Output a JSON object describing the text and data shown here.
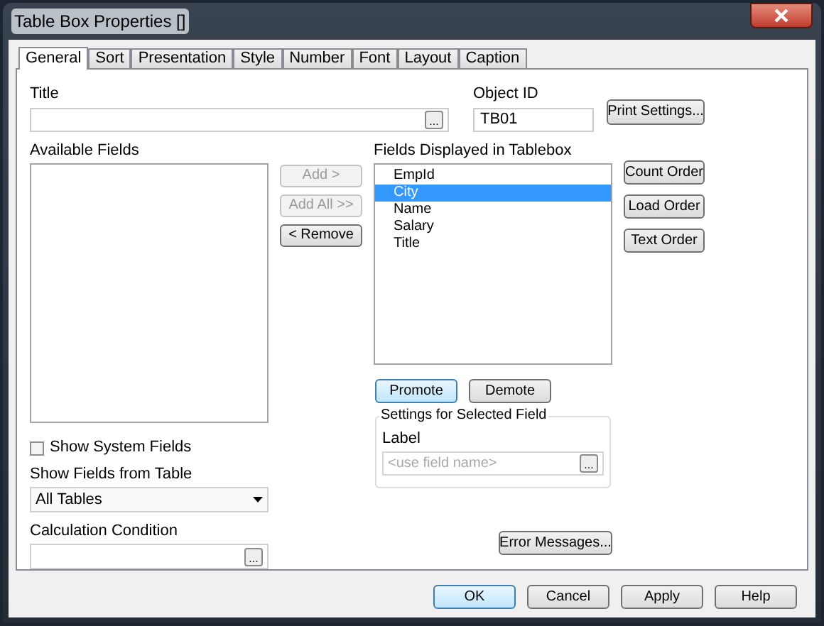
{
  "window": {
    "title": "Table Box Properties []"
  },
  "tabs": [
    {
      "label": "General",
      "selected": true
    },
    {
      "label": "Sort",
      "selected": false
    },
    {
      "label": "Presentation",
      "selected": false
    },
    {
      "label": "Style",
      "selected": false
    },
    {
      "label": "Number",
      "selected": false
    },
    {
      "label": "Font",
      "selected": false
    },
    {
      "label": "Layout",
      "selected": false
    },
    {
      "label": "Caption",
      "selected": false
    }
  ],
  "title_field": {
    "label": "Title",
    "browse": "..."
  },
  "object_id": {
    "label": "Object ID",
    "value": "TB01"
  },
  "print_settings": "Print Settings...",
  "available_fields": {
    "label": "Available Fields"
  },
  "transfer_buttons": [
    {
      "label": "Add >",
      "disabled": true
    },
    {
      "label": "Add All >>",
      "disabled": true
    },
    {
      "label": "< Remove",
      "disabled": false
    }
  ],
  "displayed_fields": {
    "label": "Fields Displayed in Tablebox",
    "items": [
      {
        "label": "EmpId",
        "selected": false
      },
      {
        "label": "City",
        "selected": true
      },
      {
        "label": "Name",
        "selected": false
      },
      {
        "label": "Salary",
        "selected": false
      },
      {
        "label": "Title",
        "selected": false
      }
    ]
  },
  "order_buttons": [
    "Count Order",
    "Load Order",
    "Text Order"
  ],
  "move_buttons": [
    {
      "label": "Promote",
      "highlighted": true
    },
    {
      "label": "Demote",
      "highlighted": false
    }
  ],
  "selected_field_settings": {
    "title": "Settings for Selected Field",
    "label": "Label",
    "placeholder": "<use field name>",
    "browse": "..."
  },
  "show_system_fields": {
    "label": "Show System Fields",
    "checked": false
  },
  "show_fields_from_table": {
    "label": "Show Fields from Table",
    "value": "All Tables"
  },
  "calculation_condition": {
    "label": "Calculation Condition",
    "browse": "..."
  },
  "error_messages": "Error Messages...",
  "footer_buttons": [
    {
      "label": "OK",
      "highlighted": true
    },
    {
      "label": "Cancel",
      "highlighted": false
    },
    {
      "label": "Apply",
      "highlighted": false
    },
    {
      "label": "Help",
      "highlighted": false
    }
  ]
}
